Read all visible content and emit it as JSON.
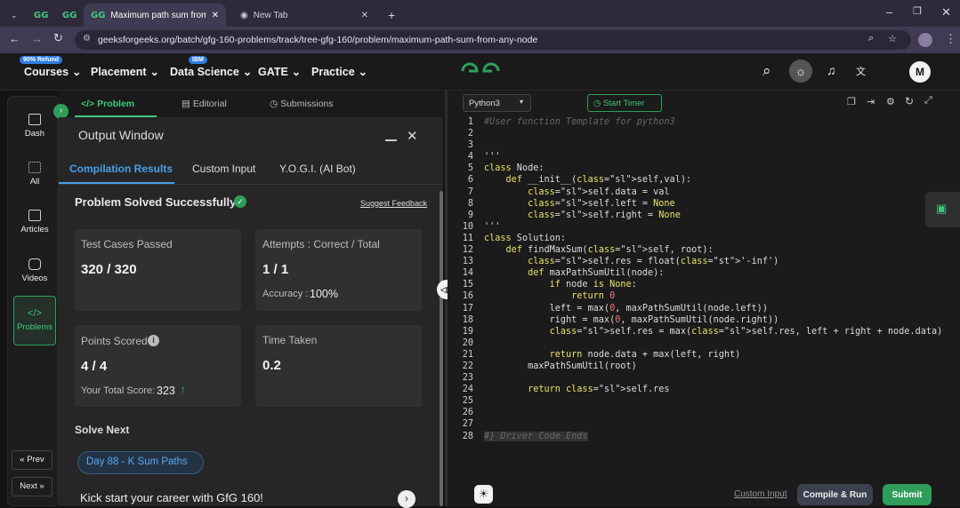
{
  "browser": {
    "tabs": [
      {
        "label": ""
      },
      {
        "label": ""
      },
      {
        "label": "Maximum path sum from any n"
      },
      {
        "label": "New Tab"
      }
    ],
    "url": "geeksforgeeks.org/batch/gfg-160-problems/track/tree-gfg-160/problem/maximum-path-sum-from-any-node"
  },
  "nav": {
    "badge_refund": "90% Refund",
    "courses": "Courses",
    "placement": "Placement",
    "badge_ibm": "IBM",
    "data_science": "Data Science",
    "gate": "GATE",
    "practice": "Practice",
    "avatar": "M"
  },
  "rail": {
    "dash": "Dash",
    "all": "All",
    "articles": "Articles",
    "videos": "Videos",
    "problems": "Problems",
    "prev": "Prev",
    "next": "Next"
  },
  "problem_tabs": {
    "problem": "Problem",
    "editorial": "Editorial",
    "submissions": "Submissions"
  },
  "output": {
    "title": "Output Window",
    "tabs": [
      "Compilation Results",
      "Custom Input",
      "Y.O.G.I. (AI Bot)"
    ],
    "status": "Problem Solved Successfully",
    "suggest": "Suggest Feedback",
    "tests_label": "Test Cases Passed",
    "tests_value": "320 / 320",
    "attempts_label": "Attempts : Correct / Total",
    "attempts_value": "1 / 1",
    "accuracy_label": "Accuracy :",
    "accuracy_value": "100%",
    "points_label": "Points Scored",
    "points_value": "4 / 4",
    "total_label": "Your Total Score:",
    "total_value": "323",
    "time_label": "Time Taken",
    "time_value": "0.2",
    "solve_next": "Solve Next",
    "next_chip": "Day 88 - K Sum Paths",
    "career": "Kick start your career with GfG 160!"
  },
  "editor": {
    "language": "Python3",
    "start_timer": "Start Timer",
    "custom_input": "Custom Input",
    "compile_run": "Compile & Run",
    "submit": "Submit",
    "lines": [
      "#User function Template for python3",
      "",
      "",
      "'''",
      "class Node:",
      "    def __init__(self,val):",
      "        self.data = val",
      "        self.left = None",
      "        self.right = None",
      "'''",
      "class Solution:",
      "    def findMaxSum(self, root):",
      "        self.res = float('-inf')",
      "        def maxPathSumUtil(node):",
      "            if node is None:",
      "                return 0",
      "            left = max(0, maxPathSumUtil(node.left))",
      "            right = max(0, maxPathSumUtil(node.right))",
      "            self.res = max(self.res, left + right + node.data)",
      "",
      "            return node.data + max(left, right)",
      "        maxPathSumUtil(root)",
      "",
      "        return self.res",
      "",
      "",
      "",
      "#} Driver Code Ends"
    ]
  }
}
